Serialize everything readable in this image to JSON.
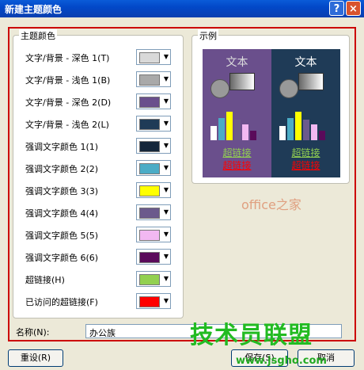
{
  "window": {
    "title": "新建主题颜色",
    "help": "?",
    "close": "×"
  },
  "theme_group": {
    "title": "主题颜色"
  },
  "rows": [
    {
      "label": "文字/背景 - 深色 1(T)",
      "color": "#d9d9d9"
    },
    {
      "label": "文字/背景 - 浅色 1(B)",
      "color": "#a9a9a9"
    },
    {
      "label": "文字/背景 - 深色 2(D)",
      "color": "#6a4f8c"
    },
    {
      "label": "文字/背景 - 浅色 2(L)",
      "color": "#1f3b57"
    },
    {
      "label": "强调文字颜色 1(1)",
      "color": "#14263a"
    },
    {
      "label": "强调文字颜色 2(2)",
      "color": "#4bacc6"
    },
    {
      "label": "强调文字颜色 3(3)",
      "color": "#ffff00"
    },
    {
      "label": "强调文字颜色 4(4)",
      "color": "#6b5a8c"
    },
    {
      "label": "强调文字颜色 5(5)",
      "color": "#f2b8f2"
    },
    {
      "label": "强调文字颜色 6(6)",
      "color": "#5a0a5a"
    },
    {
      "label": "超链接(H)",
      "color": "#92d050"
    },
    {
      "label": "已访问的超链接(F)",
      "color": "#ff0000"
    }
  ],
  "sample": {
    "title": "示例",
    "text": "文本",
    "hyperlink": "超链接",
    "visited": "超链接",
    "left_bg": "#6a4f8c",
    "right_bg": "#1f3b57",
    "bar_colors": [
      "#ffffff",
      "#4bacc6",
      "#ffff00",
      "#6b5a8c",
      "#f2b8f2",
      "#5a0a5a"
    ]
  },
  "name": {
    "label": "名称(N):",
    "value": "办公族"
  },
  "buttons": {
    "reset": "重设(R)",
    "save": "保存(S)",
    "cancel": "取消"
  },
  "watermarks": {
    "office": "office之家",
    "brand": "技术员联盟",
    "url": "www.jsgho.com"
  }
}
